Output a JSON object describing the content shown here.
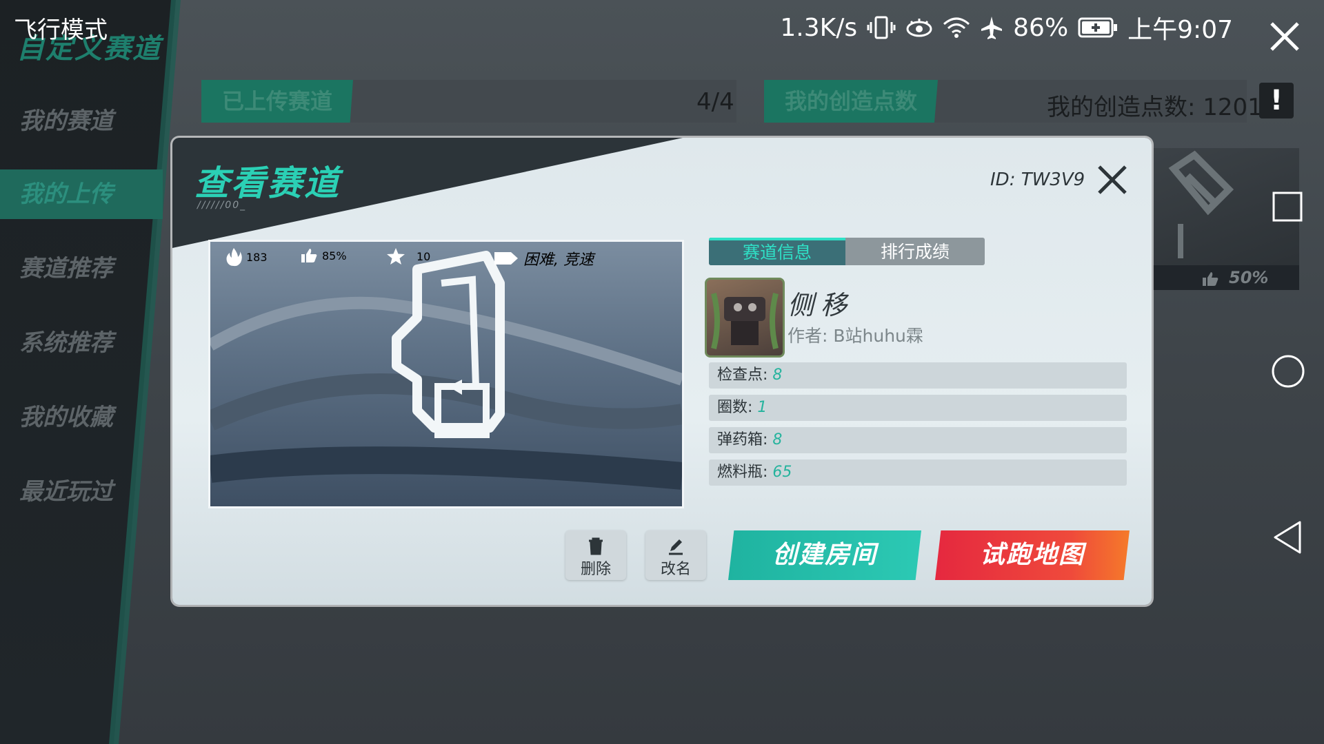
{
  "status_bar": {
    "mode": "飞行模式",
    "speed": "1.3K/s",
    "battery": "86%",
    "time": "上午9:07"
  },
  "sidebar": {
    "title": "自定义赛道",
    "items": [
      {
        "label": "我的赛道"
      },
      {
        "label": "我的上传"
      },
      {
        "label": "赛道推荐"
      },
      {
        "label": "系统推荐"
      },
      {
        "label": "我的收藏"
      },
      {
        "label": "最近玩过"
      }
    ]
  },
  "top_bar": {
    "uploaded_label": "已上传赛道",
    "uploaded_count": "4/4",
    "points_tab": "我的创造点数",
    "points_text": "我的创造点数: 1201",
    "info_icon": "!"
  },
  "bg_card": {
    "likes": "50%"
  },
  "dialog": {
    "title": "查看赛道",
    "title_deco": "//////00_",
    "id": "ID: TW3V9",
    "tabs": [
      "赛道信息",
      "排行成绩"
    ],
    "track_name": "侧移",
    "author": "作者: B站huhu霖",
    "stats": {
      "plays": "183",
      "likes": "85%",
      "stars": "10",
      "tags": "困难, 竞速"
    },
    "info": [
      {
        "label": "检查点:",
        "value": "8"
      },
      {
        "label": "圈数:",
        "value": "1"
      },
      {
        "label": "弹药箱:",
        "value": "8"
      },
      {
        "label": "燃料瓶:",
        "value": "65"
      }
    ],
    "buttons": {
      "delete": "删除",
      "rename": "改名",
      "create_room": "创建房间",
      "test_run": "试跑地图"
    }
  },
  "colors": {
    "accent": "#2bd0b5",
    "create_button": "#1fb3a0",
    "test_button": "#e5283f"
  }
}
